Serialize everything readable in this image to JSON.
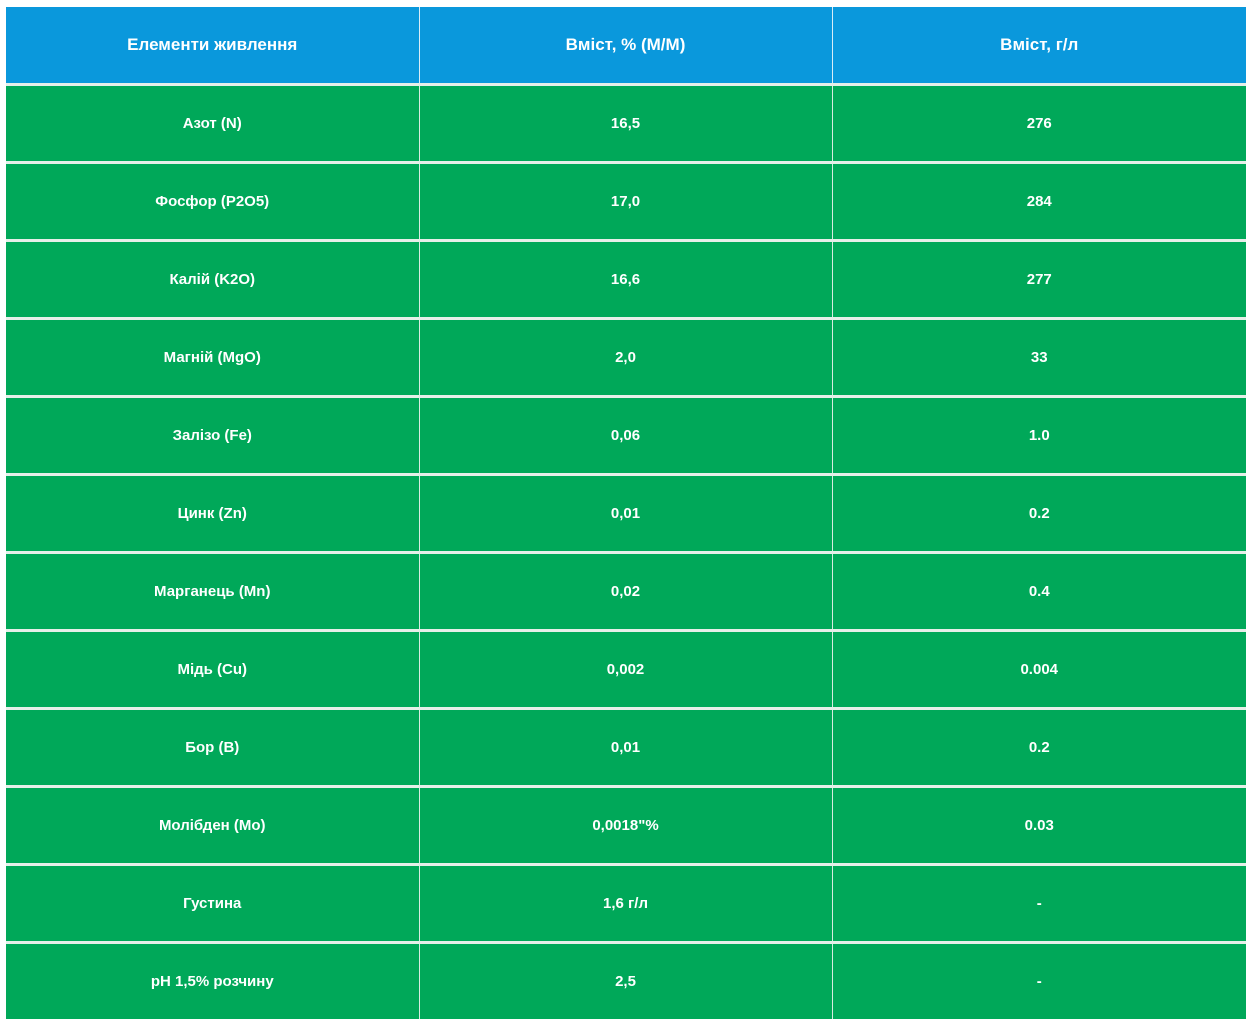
{
  "table": {
    "headers": [
      "Елементи живлення",
      "Вміст, % (M/M)",
      "Вміст, г/л"
    ],
    "rows": [
      [
        "Азот (N)",
        "16,5",
        "276"
      ],
      [
        "Фосфор (P2O5)",
        "17,0",
        "284"
      ],
      [
        "Калій (K2O)",
        "16,6",
        "277"
      ],
      [
        "Магній (MgO)",
        "2,0",
        "33"
      ],
      [
        "Залізо (Fe)",
        "0,06",
        "1.0"
      ],
      [
        "Цинк (Zn)",
        "0,01",
        "0.2"
      ],
      [
        "Марганець (Mn)",
        "0,02",
        "0.4"
      ],
      [
        "Мідь (Cu)",
        "0,002",
        "0.004"
      ],
      [
        "Бор (B)",
        "0,01",
        "0.2"
      ],
      [
        "Молібден (Mo)",
        "0,0018\"%",
        "0.03"
      ],
      [
        "Густина",
        "1,6 г/л",
        "-"
      ],
      [
        "pH 1,5% розчину",
        "2,5",
        "-"
      ]
    ]
  },
  "colors": {
    "header_bg": "#0a98dc",
    "row_bg": "#00a859",
    "text": "#ffffff"
  }
}
